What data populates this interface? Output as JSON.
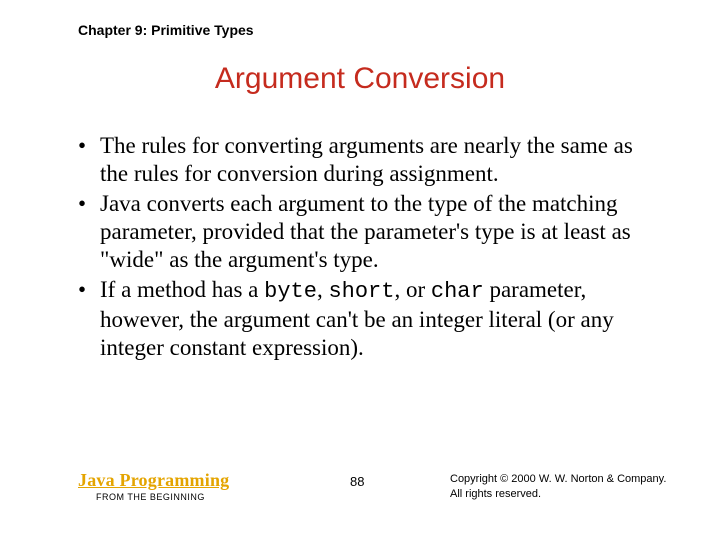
{
  "chapter": "Chapter 9: Primitive Types",
  "title": "Argument Conversion",
  "bullets": [
    {
      "pre": "The rules for converting arguments are nearly the same as the rules for conversion during assignment."
    },
    {
      "pre": "Java converts each argument to the type of the matching parameter, provided that the parameter's type is at least as \"wide\" as the argument's type."
    },
    {
      "pre": "If a method has a ",
      "code1": "byte",
      "mid1": ", ",
      "code2": "short",
      "mid2": ", or ",
      "code3": "char",
      "post": " parameter, however, the argument can't be an integer literal (or any integer constant expression)."
    }
  ],
  "footer": {
    "book_title": "Java Programming",
    "book_sub": "FROM THE BEGINNING",
    "page": "88",
    "copyright_line1": "Copyright © 2000 W. W. Norton & Company.",
    "copyright_line2": "All rights reserved."
  }
}
